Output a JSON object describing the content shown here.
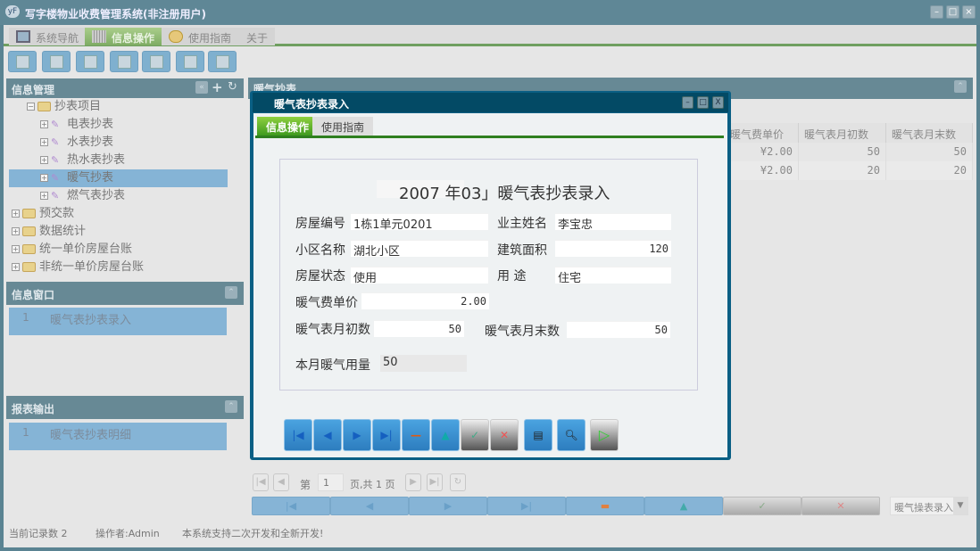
{
  "window": {
    "title": "写字楼物业收费管理系统(非注册用户)",
    "app_icon": "yF"
  },
  "main_tabs": [
    {
      "label": "系统导航"
    },
    {
      "label": "信息操作"
    },
    {
      "label": "使用指南"
    },
    {
      "label": "关于"
    }
  ],
  "toolbar_icons": [
    "search-doc-icon",
    "list-icon",
    "document-icon",
    "users-icon",
    "window-icon",
    "add-window-icon",
    "calendar-icon"
  ],
  "sidebar": {
    "tree_title": "信息管理",
    "tree": [
      {
        "label": "抄表项目"
      },
      {
        "label": "电表抄表"
      },
      {
        "label": "水表抄表"
      },
      {
        "label": "热水表抄表"
      },
      {
        "label": "暖气抄表"
      },
      {
        "label": "燃气表抄表"
      },
      {
        "label": "预交款"
      },
      {
        "label": "数据统计"
      },
      {
        "label": "统一单价房屋台账"
      },
      {
        "label": "非统一单价房屋台账"
      }
    ],
    "window_panel": {
      "title": "信息窗口",
      "items": [
        {
          "num": "1",
          "label": "暖气表抄表录入"
        }
      ]
    },
    "report_panel": {
      "title": "报表输出",
      "items": [
        {
          "num": "1",
          "label": "暖气表抄表明细"
        }
      ]
    }
  },
  "grid": {
    "title": "暖气抄表",
    "columns": [
      "暖气费单价",
      "暖气表月初数",
      "暖气表月末数"
    ],
    "rows": [
      [
        "¥2.00",
        "50",
        "50"
      ],
      [
        "¥2.00",
        "20",
        "20"
      ]
    ]
  },
  "pager": {
    "page_label": "第",
    "page": "1",
    "total": "页,共 1 页"
  },
  "bottom_select": "暖气操表录入",
  "status": {
    "records": "当前记录数 2",
    "operator": "操作者:Admin",
    "message": "本系统支持二次开发和全新开发!"
  },
  "modal": {
    "title": "暖气表抄表录入",
    "tabs": [
      {
        "label": "信息操作"
      },
      {
        "label": "使用指南"
      }
    ],
    "heading_year": "2007 年03",
    "heading_text": "」暖气表抄表录入",
    "fields": {
      "house_no": {
        "label": "房屋编号",
        "value": "1栋1单元0201"
      },
      "owner": {
        "label": "业主姓名",
        "value": "李宝忠"
      },
      "community": {
        "label": "小区名称",
        "value": "湖北小区"
      },
      "area": {
        "label": "建筑面积",
        "value": "120"
      },
      "status": {
        "label": "房屋状态",
        "value": "使用"
      },
      "usage": {
        "label": "用 途",
        "value": "住宅"
      },
      "unit_price": {
        "label": "暖气费单价",
        "value": "2.00"
      },
      "start": {
        "label": "暖气表月初数",
        "value": "50"
      },
      "end": {
        "label": "暖气表月末数",
        "value": "50"
      },
      "usage_amount": {
        "label": "本月暖气用量",
        "value": "50"
      }
    }
  }
}
